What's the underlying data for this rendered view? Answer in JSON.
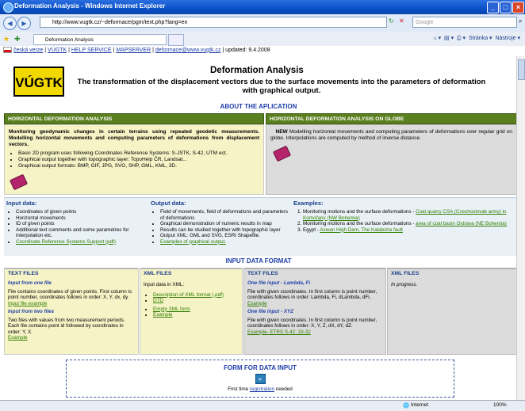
{
  "window": {
    "title": "Deformation Analysis - Windows Internet Explorer"
  },
  "nav": {
    "url": "http://www.vugtk.cz/~deformace/pgm/text.php?lang=en",
    "search_placeholder": "Google"
  },
  "tab": {
    "label": "Deformation Analysis"
  },
  "toolbar": {
    "page": "Stránka",
    "tools": "Nástroje"
  },
  "infobar": {
    "czech": "česká verze",
    "vugtk": "VÚGTK",
    "help": "HELP SERVICE",
    "mapserver": "MAPSERVER",
    "email": "deformace@www.vugtk.cz",
    "updated": "updated: 9.4.2008"
  },
  "header": {
    "logo_text": "VÚGTK",
    "title": "Deformation Analysis",
    "subtitle": "The transformation of the displacement vectors due to the surface movements into the parameters of deformation with graphical output."
  },
  "about": {
    "heading": "ABOUT THE APLICATION",
    "left_header": "HORIZONTAL DEFORMATION ANALYSIS",
    "right_header": "HORIZONTAL DEFORMATION ANALYSIS ON GLOBE",
    "left_text": "Monitoring geodynamic changes in certain terrains using repeated geodetic measurements. Modelling horizontal movements and computing parameters of deformations from displacement vectors.",
    "left_items": [
      "Basic 2D program uses following Coordinates Reference Systems: S-JSTK, S-42, UTM ect.",
      "Graphical output together with topographic layer: TopoHelp ČR, Landsat...",
      "Graphical output formats: BMP, GIF, JPG, SVG, SHP, GML, KML, 3D."
    ],
    "right_new": "NEW",
    "right_text": "Modelling horizontal movements and computing parameters of deformations over regular grid on globe. Interpolations are computed by method of inverse distance."
  },
  "input_data": {
    "heading": "Input data:",
    "items": [
      "Coordinates of given points",
      "Horizontal movements",
      "ID of given points",
      "Additional text comments and some parametres for interpolation etc."
    ],
    "link": "Coordinate Reference Systems Support (pdf)"
  },
  "output_data": {
    "heading": "Output data:",
    "items": [
      "Field of movements, field of deformations and parameters of deformations",
      "Graphical demonstration of numeric results in map",
      "Results can be studied together with topographic layer",
      "Output XML: GML and SVG, ESRI Shapefile."
    ],
    "link": "Examples of graphical output."
  },
  "examples": {
    "heading": "Examples:",
    "items": [
      {
        "text": "Monitoring motions and the surface deformations - ",
        "link": "Coal quarry CSA (Czechoslovak army) in Komořany (NW Bohemia)"
      },
      {
        "text": "Monitoring motions and the surface deformations - ",
        "link": "area of coal basin Ostrava (NE Bohemia)"
      },
      {
        "text": "Egypt - ",
        "link": "Aswan High Dam, The Kalabsha fault"
      }
    ]
  },
  "format": {
    "heading": "INPUT DATA FORMAT",
    "col1": {
      "header": "TEXT FILES",
      "sub1": "Input from one file",
      "text1": "File contains coordinates of given points. First column is point number, coordinates follows in order: X, Y, dx, dy.",
      "link1": "Input file example",
      "sub2": "Input from two files",
      "text2": "Two files with values from two measurement periods. Each file contains point id followed by coordinates in order: Y, X.",
      "link2": "Example"
    },
    "col2": {
      "header": "XML FILES",
      "intro": "Input data in XML:",
      "links": [
        "Description of XML format (.pdf)",
        "DTD",
        "Empty XML form",
        "Example"
      ]
    },
    "col3": {
      "header": "TEXT FILES",
      "sub1": "One file input - Lambda, Fi",
      "text1": "File with given coordinates. In first column is point number, coordinates follows in order: Lambda, Fi, dLambda, dFi.",
      "link1": "Example",
      "sub2": "One file input - XYZ",
      "text2": "File with given coordinates. In first column is point number, coordinates follows in order: X, Y, Z, dX, dY, dZ.",
      "link2": "Example- ETRS S-42: 33-32"
    },
    "col4": {
      "header": "XML FILES",
      "text": "In progress."
    }
  },
  "form": {
    "heading": "FORM FOR DATA INPUT",
    "text_before": "First time ",
    "link": "registration",
    "text_after": " needed"
  },
  "status": {
    "zone": "Internet",
    "zoom": "100%"
  },
  "colors": {
    "green_header": "#5a7f1e",
    "yellow_body": "#f6f3c6",
    "link_blue": "#1f3faa"
  }
}
